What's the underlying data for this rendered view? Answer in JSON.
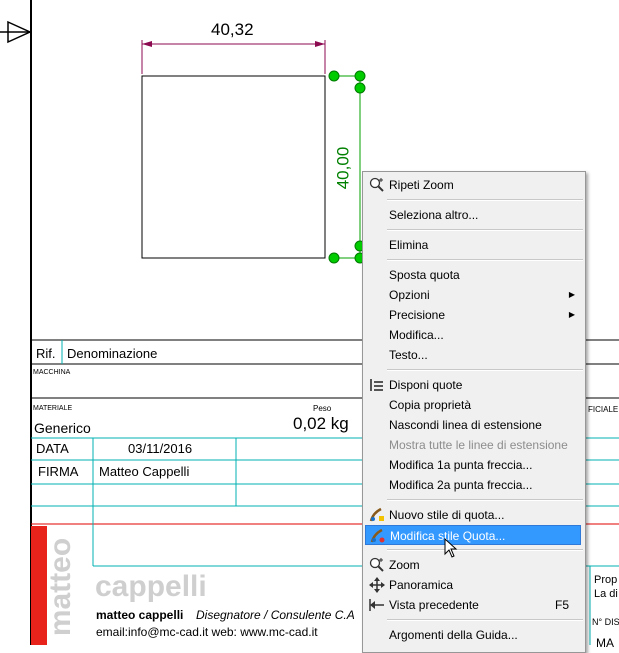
{
  "drawing": {
    "dimension_horizontal": "40,32",
    "dimension_vertical": "40,00"
  },
  "title_block": {
    "rif_label": "Rif.",
    "denominazione_label": "Denominazione",
    "macchina_label": "MACCHINA",
    "materiale_label": "MATERIALE",
    "materiale_value": "Generico",
    "peso_label": "Peso",
    "peso_value": "0,02 kg",
    "data_label": "DATA",
    "data_value": "03/11/2016",
    "firma_label": "FIRMA",
    "firma_value": "Matteo Cappelli",
    "logo_word_vertical": "matteo",
    "logo_word": "cappelli",
    "company_name": "matteo cappelli",
    "company_role": "Disegnatore / Consulente C.A",
    "contact": "email:info@mc-cad.it  web: www.mc-cad.it",
    "right_partial_1": "FICIALE",
    "right_partial_2": "Prop",
    "right_partial_3": "La di",
    "right_partial_4": "N° DIS",
    "right_partial_5": "MA"
  },
  "context_menu": {
    "items": [
      {
        "label": "Ripeti Zoom",
        "icon": "zoom-plus-icon"
      },
      {
        "label": "Seleziona altro..."
      },
      {
        "label": "Elimina"
      },
      {
        "label": "Sposta quota"
      },
      {
        "label": "Opzioni",
        "submenu": true
      },
      {
        "label": "Precisione",
        "submenu": true
      },
      {
        "label": "Modifica..."
      },
      {
        "label": "Testo..."
      },
      {
        "label": "Disponi quote",
        "icon": "arrange-dimensions-icon"
      },
      {
        "label": "Copia proprietà"
      },
      {
        "label": "Nascondi linea di estensione"
      },
      {
        "label": "Mostra tutte le linee di estensione",
        "disabled": true
      },
      {
        "label": "Modifica 1a punta freccia..."
      },
      {
        "label": "Modifica 2a punta freccia..."
      },
      {
        "label": "Nuovo stile di quota...",
        "icon": "new-dim-style-icon"
      },
      {
        "label": "Modifica stile Quota...",
        "icon": "edit-dim-style-icon",
        "highlighted": true
      },
      {
        "label": "Zoom",
        "icon": "zoom-plus-icon"
      },
      {
        "label": "Panoramica",
        "icon": "pan-icon"
      },
      {
        "label": "Vista precedente",
        "icon": "previous-view-icon",
        "shortcut": "F5"
      },
      {
        "label": "Argomenti della Guida..."
      }
    ]
  },
  "colors": {
    "dimension_selected": "#00a000",
    "handle": "#00cc00",
    "dimension_line": "#8b0a50",
    "table_line": "#00b0b0",
    "red_line": "#e00000",
    "logo_red": "#e8231c",
    "logo_grey": "#cfcfcf",
    "menu_highlight": "#3399ff"
  }
}
